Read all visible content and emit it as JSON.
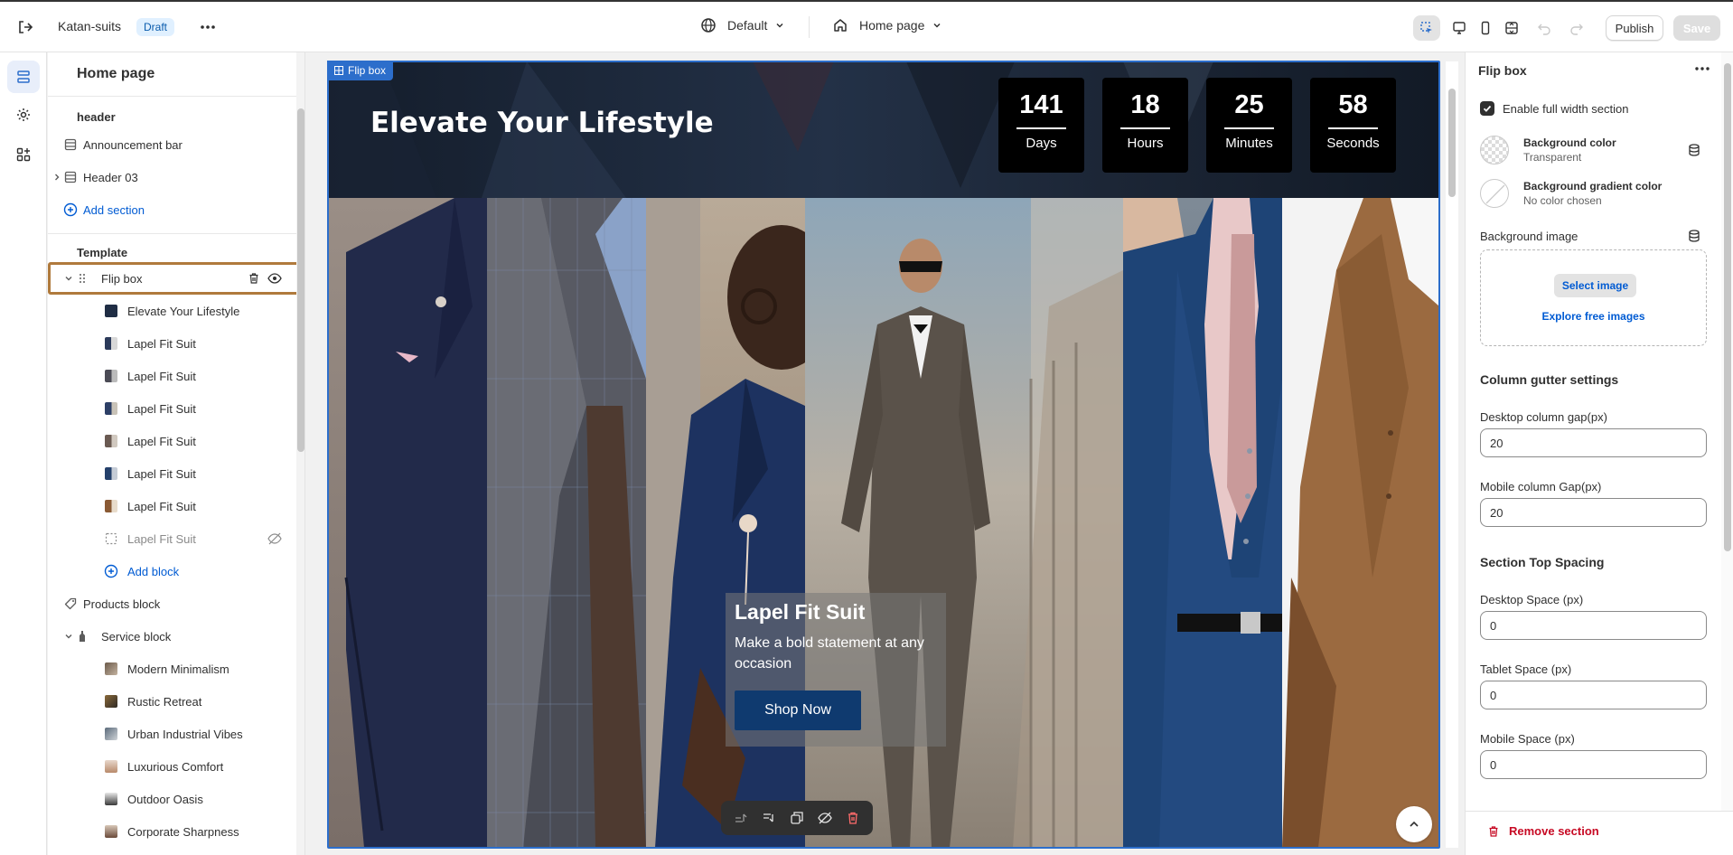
{
  "topbar": {
    "store_name": "Katan-suits",
    "status_badge": "Draft",
    "theme_label": "Default",
    "page_label": "Home page",
    "publish_label": "Publish",
    "save_label": "Save"
  },
  "left_panel": {
    "title": "Home page",
    "header_group": {
      "heading": "header",
      "items": [
        {
          "label": "Announcement bar",
          "icon": "section-icon"
        },
        {
          "label": "Header 03",
          "icon": "section-icon"
        }
      ],
      "add_label": "Add section"
    },
    "template_group": {
      "heading": "Template",
      "selected_section": "Flip box",
      "blocks": [
        {
          "label": "Elevate Your Lifestyle",
          "thumb": "#1f2d44"
        },
        {
          "label": "Lapel Fit Suit",
          "thumb": "#3a4a66"
        },
        {
          "label": "Lapel Fit Suit",
          "thumb": "#4b4b55"
        },
        {
          "label": "Lapel Fit Suit",
          "thumb": "#2d3f66"
        },
        {
          "label": "Lapel Fit Suit",
          "thumb": "#6a5a52"
        },
        {
          "label": "Lapel Fit Suit",
          "thumb": "#24406b"
        },
        {
          "label": "Lapel Fit Suit",
          "thumb": "#8a5a34"
        },
        {
          "label": "Lapel Fit Suit",
          "thumb": "hidden"
        }
      ],
      "add_block_label": "Add block",
      "products_block": "Products block",
      "service_block": "Service block",
      "service_items": [
        {
          "label": "Modern Minimalism",
          "thumb": "#6b5a4a"
        },
        {
          "label": "Rustic Retreat",
          "thumb": "#8a6a3a"
        },
        {
          "label": "Urban Industrial Vibes",
          "thumb": "#5a6a7a"
        },
        {
          "label": "Luxurious Comfort",
          "thumb": "#b88a6a"
        },
        {
          "label": "Outdoor Oasis",
          "thumb": "#3a3a3a"
        },
        {
          "label": "Corporate Sharpness",
          "thumb": "#6a4a3a"
        }
      ]
    }
  },
  "canvas": {
    "selection_label": "Flip box",
    "hero_title": "Elevate Your Lifestyle",
    "countdown": [
      {
        "value": "141",
        "label": "Days"
      },
      {
        "value": "18",
        "label": "Hours"
      },
      {
        "value": "25",
        "label": "Minutes"
      },
      {
        "value": "58",
        "label": "Seconds"
      }
    ],
    "card": {
      "title": "Lapel Fit Suit",
      "text": "Make a bold statement at any occasion",
      "button": "Shop Now"
    }
  },
  "right_panel": {
    "title": "Flip box",
    "enable_full_width": {
      "label": "Enable full width section",
      "checked": true
    },
    "background_color": {
      "label": "Background color",
      "value": "Transparent"
    },
    "background_gradient": {
      "label": "Background gradient color",
      "value": "No color chosen"
    },
    "background_image": {
      "label": "Background image",
      "select_label": "Select image",
      "explore_label": "Explore free images"
    },
    "column_gutter": {
      "heading": "Column gutter settings",
      "desktop_label": "Desktop column gap(px)",
      "desktop_value": "20",
      "mobile_label": "Mobile column Gap(px)",
      "mobile_value": "20"
    },
    "top_spacing": {
      "heading": "Section Top Spacing",
      "desktop_label": "Desktop Space (px)",
      "desktop_value": "0",
      "tablet_label": "Tablet Space (px)",
      "tablet_value": "0",
      "mobile_label": "Mobile Space (px)",
      "mobile_value": "0"
    },
    "remove_label": "Remove section"
  },
  "colors": {
    "accent": "#005bd3",
    "selection": "#2c6ecb",
    "danger": "#c70a24",
    "button_navy": "#0f3a6f"
  }
}
